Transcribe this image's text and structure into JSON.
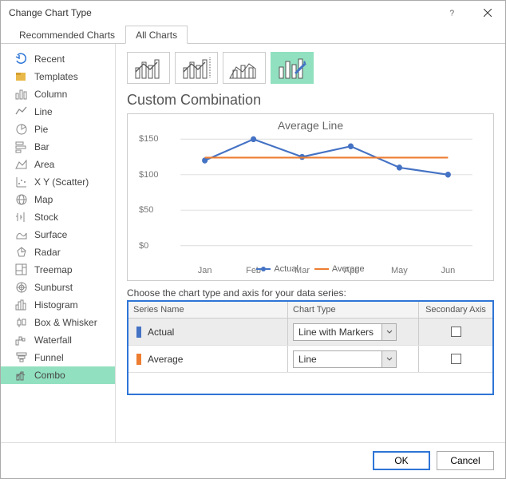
{
  "window": {
    "title": "Change Chart Type"
  },
  "tabs": {
    "recommended": "Recommended Charts",
    "all": "All Charts"
  },
  "sidebar": {
    "items": [
      {
        "label": "Recent"
      },
      {
        "label": "Templates"
      },
      {
        "label": "Column"
      },
      {
        "label": "Line"
      },
      {
        "label": "Pie"
      },
      {
        "label": "Bar"
      },
      {
        "label": "Area"
      },
      {
        "label": "X Y (Scatter)"
      },
      {
        "label": "Map"
      },
      {
        "label": "Stock"
      },
      {
        "label": "Surface"
      },
      {
        "label": "Radar"
      },
      {
        "label": "Treemap"
      },
      {
        "label": "Sunburst"
      },
      {
        "label": "Histogram"
      },
      {
        "label": "Box & Whisker"
      },
      {
        "label": "Waterfall"
      },
      {
        "label": "Funnel"
      },
      {
        "label": "Combo"
      }
    ]
  },
  "main": {
    "section_title": "Custom Combination",
    "series_label": "Choose the chart type and axis for your data series:",
    "headers": {
      "name": "Series Name",
      "type": "Chart Type",
      "axis": "Secondary Axis"
    },
    "series": [
      {
        "name": "Actual",
        "chart_type": "Line with Markers"
      },
      {
        "name": "Average",
        "chart_type": "Line"
      }
    ]
  },
  "footer": {
    "ok": "OK",
    "cancel": "Cancel"
  },
  "chart_data": {
    "type": "line",
    "title": "Average Line",
    "categories": [
      "Jan",
      "Feb",
      "Mar",
      "Apr",
      "May",
      "Jun"
    ],
    "series": [
      {
        "name": "Actual",
        "values": [
          120,
          150,
          125,
          140,
          110,
          100
        ],
        "style": "line-markers",
        "color": "#4472c4"
      },
      {
        "name": "Average",
        "values": [
          124,
          124,
          124,
          124,
          124,
          124
        ],
        "style": "line",
        "color": "#ed7d31"
      }
    ],
    "ylabel": "",
    "xlabel": "",
    "ylim": [
      0,
      150
    ],
    "yticks": [
      "$0",
      "$50",
      "$100",
      "$150"
    ],
    "legend": [
      "Actual",
      "Average"
    ]
  }
}
